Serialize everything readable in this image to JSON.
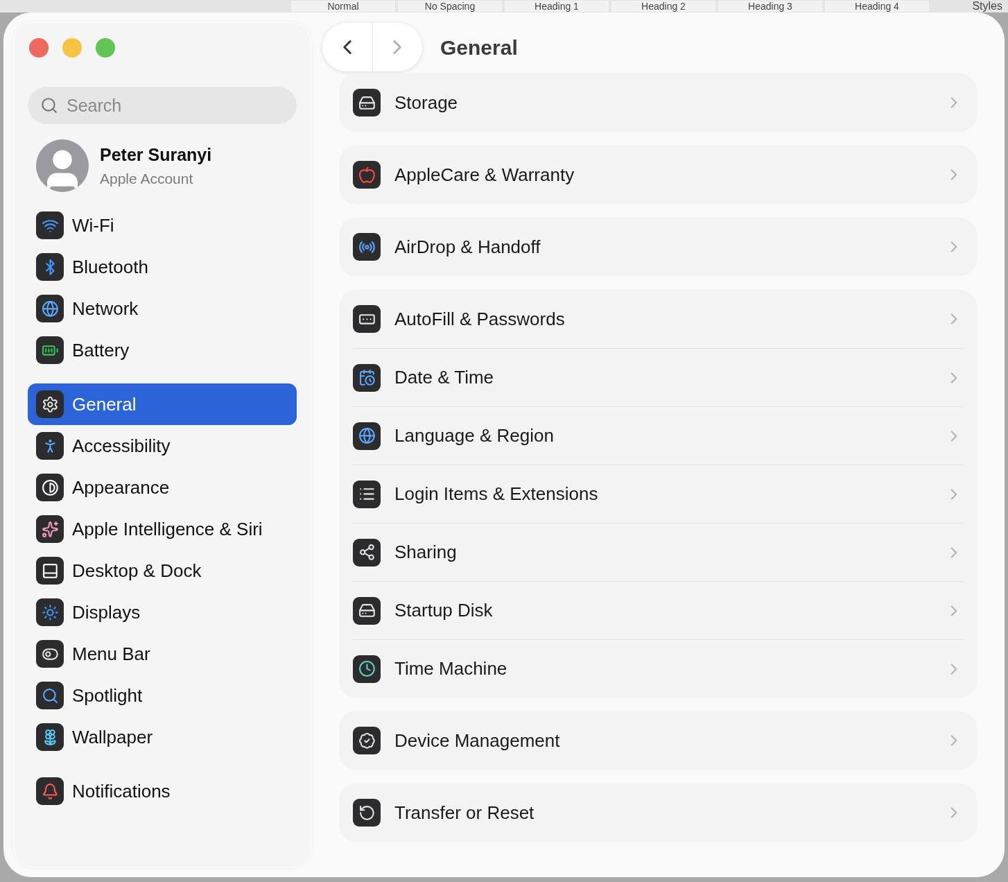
{
  "background_toolbar": {
    "styles": [
      "Normal",
      "No Spacing",
      "Heading 1",
      "Heading 2",
      "Heading 3",
      "Heading 4"
    ],
    "label": "Styles"
  },
  "window": {
    "title": "General",
    "back": {
      "disabled": false
    },
    "forward": {
      "disabled": true
    }
  },
  "sidebar": {
    "search": {
      "placeholder": "Search"
    },
    "account": {
      "name": "Peter Suranyi",
      "subtitle": "Apple Account"
    },
    "sections": [
      {
        "items": [
          {
            "label": "Wi-Fi",
            "selected": false
          },
          {
            "label": "Bluetooth",
            "selected": false
          },
          {
            "label": "Network",
            "selected": false
          },
          {
            "label": "Battery",
            "selected": false
          }
        ]
      },
      {
        "items": [
          {
            "label": "General",
            "selected": true
          },
          {
            "label": "Accessibility",
            "selected": false
          },
          {
            "label": "Appearance",
            "selected": false
          },
          {
            "label": "Apple Intelligence & Siri",
            "selected": false
          },
          {
            "label": "Desktop & Dock",
            "selected": false
          },
          {
            "label": "Displays",
            "selected": false
          },
          {
            "label": "Menu Bar",
            "selected": false
          },
          {
            "label": "Spotlight",
            "selected": false
          },
          {
            "label": "Wallpaper",
            "selected": false
          }
        ]
      },
      {
        "items": [
          {
            "label": "Notifications",
            "selected": false
          }
        ]
      }
    ]
  },
  "content": {
    "groups": [
      {
        "rows": [
          "Storage"
        ]
      },
      {
        "rows": [
          "AppleCare & Warranty"
        ]
      },
      {
        "rows": [
          "AirDrop & Handoff"
        ]
      },
      {
        "rows": [
          "AutoFill & Passwords",
          "Date & Time",
          "Language & Region",
          "Login Items & Extensions",
          "Sharing",
          "Startup Disk",
          "Time Machine"
        ]
      },
      {
        "rows": [
          "Device Management"
        ]
      },
      {
        "rows": [
          "Transfer or Reset"
        ]
      }
    ]
  }
}
